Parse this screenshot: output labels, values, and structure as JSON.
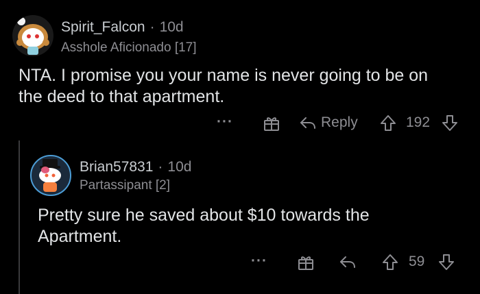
{
  "comments": [
    {
      "username": "Spirit_Falcon",
      "separator": "·",
      "age": "10d",
      "flair": "Asshole Aficionado [17]",
      "body": "NTA. I promise you your name is never going to be on the deed to that apartment.",
      "actions": {
        "more": "···",
        "reply_label": "Reply",
        "score": "192"
      }
    },
    {
      "username": "Brian57831",
      "separator": "·",
      "age": "10d",
      "flair": "Partassipant [2]",
      "body": "Pretty sure he saved about $10 towards the Apartment.",
      "actions": {
        "more": "···",
        "score": "59"
      }
    }
  ],
  "colors": {
    "background": "#000000",
    "text": "#e2e4e6",
    "muted": "#8e8e93",
    "thread_line": "#3a3a3c"
  },
  "icons": [
    "avatar",
    "more-icon",
    "gift-icon",
    "reply-icon",
    "upvote-icon",
    "downvote-icon"
  ]
}
